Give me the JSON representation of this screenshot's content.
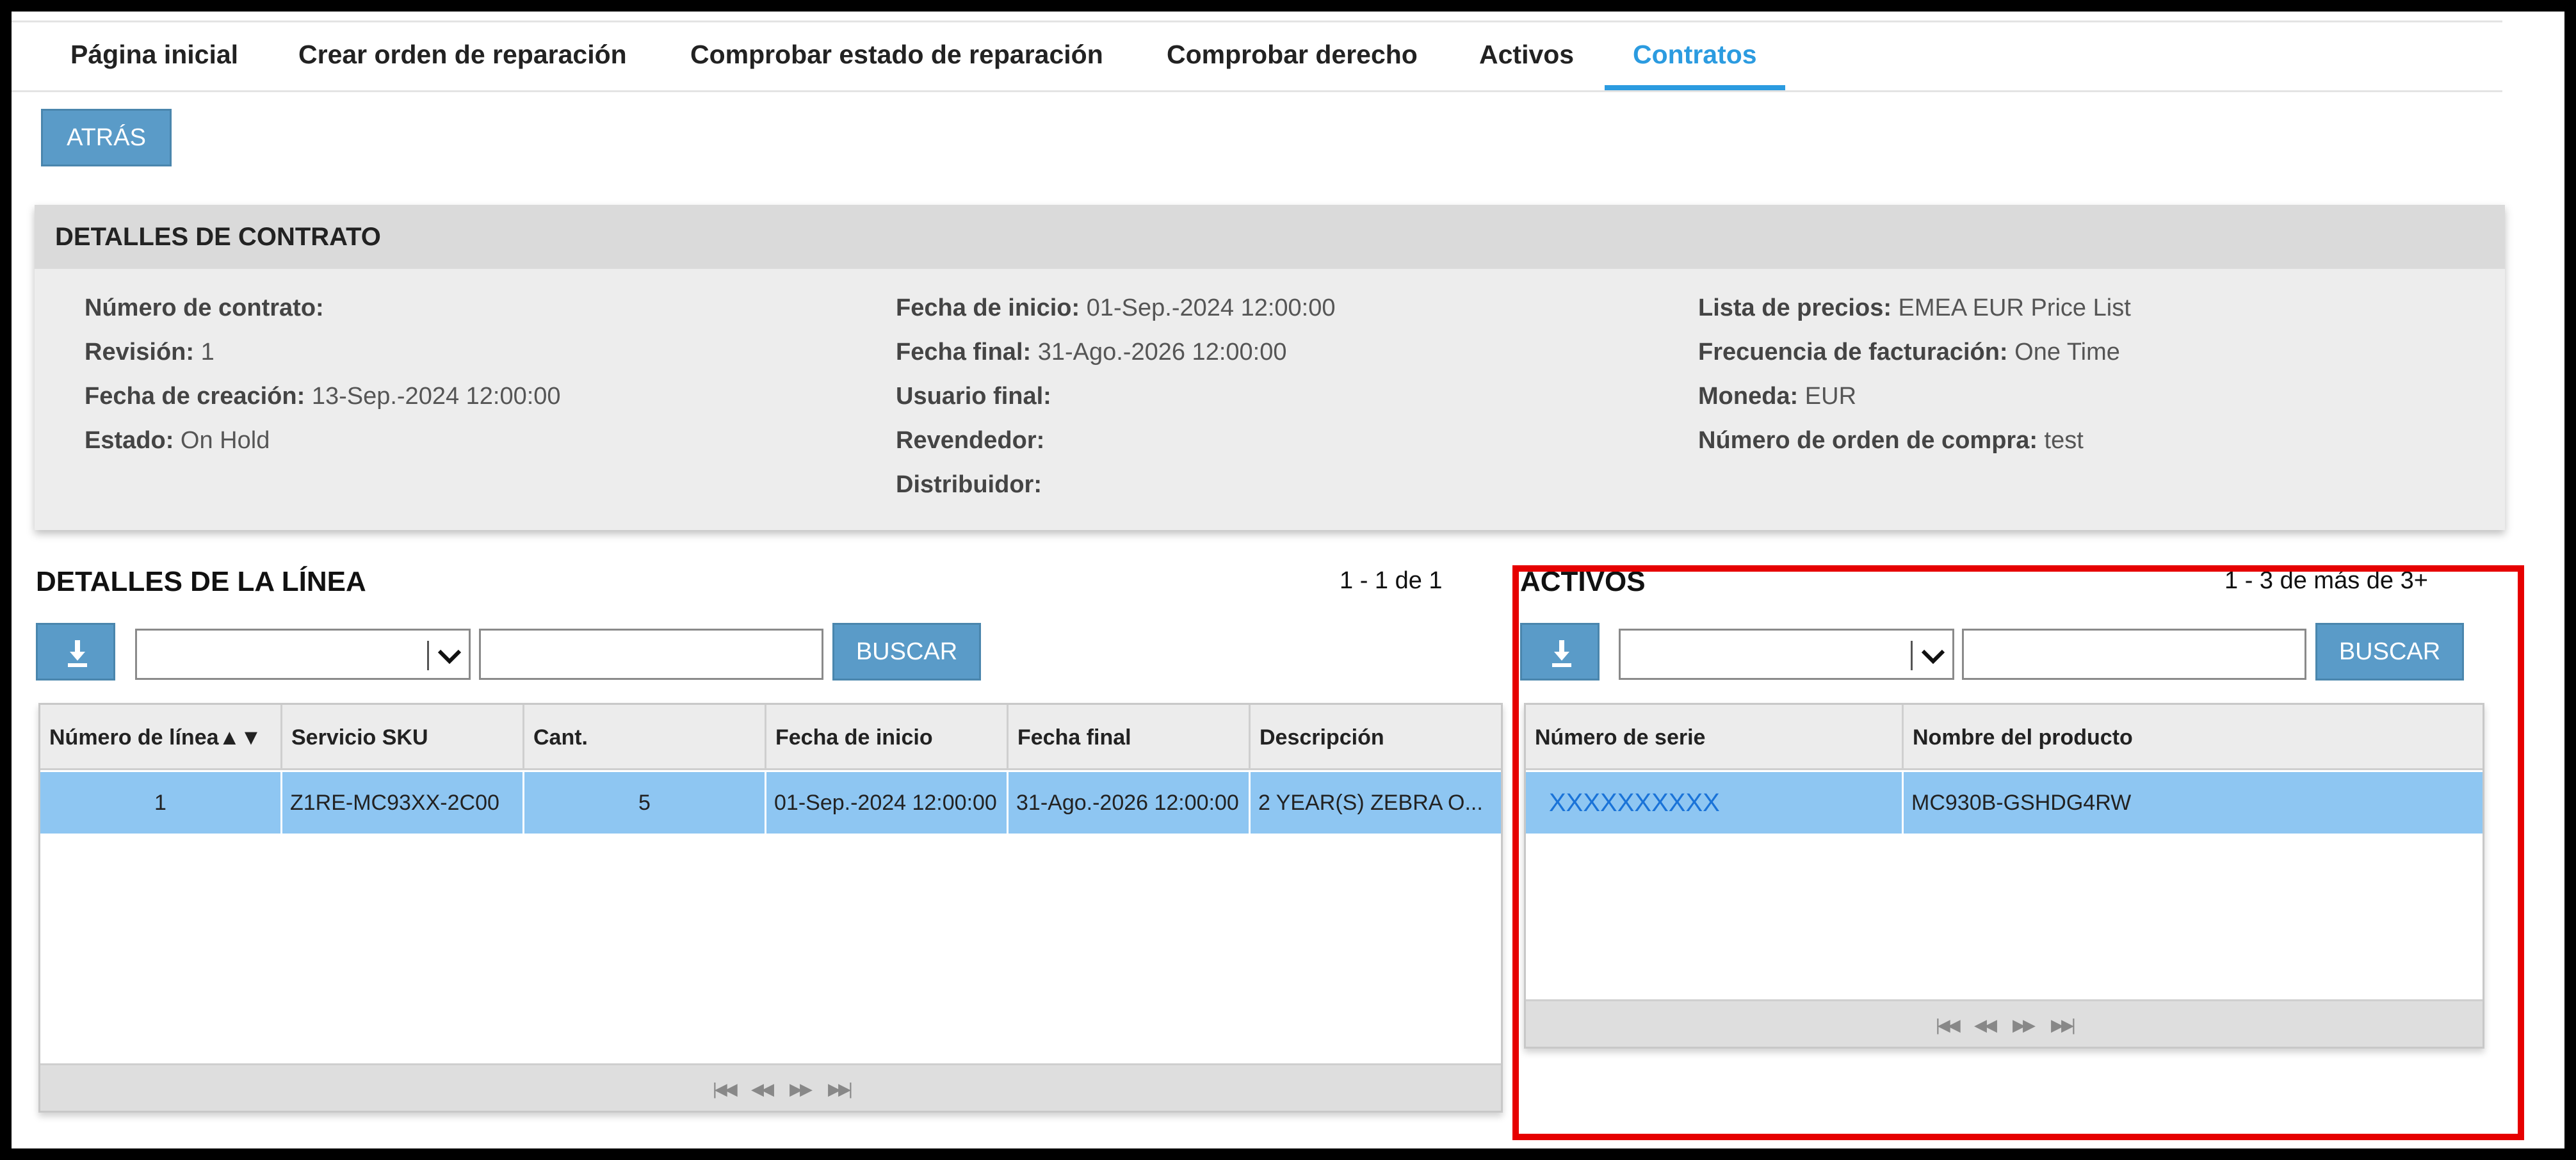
{
  "nav": {
    "tabs": [
      {
        "label": "Página inicial"
      },
      {
        "label": "Crear orden de reparación"
      },
      {
        "label": "Comprobar estado de reparación"
      },
      {
        "label": "Comprobar derecho"
      },
      {
        "label": "Activos"
      },
      {
        "label": "Contratos",
        "active": true
      }
    ]
  },
  "back_button": "ATRÁS",
  "contract": {
    "title": "DETALLES DE CONTRATO",
    "col1": [
      {
        "label": "Número de contrato:",
        "value": ""
      },
      {
        "label": "Revisión:",
        "value": "1"
      },
      {
        "label": "Fecha de creación:",
        "value": "13-Sep.-2024 12:00:00"
      },
      {
        "label": "Estado:",
        "value": "On Hold"
      }
    ],
    "col2": [
      {
        "label": "Fecha de inicio:",
        "value": "01-Sep.-2024 12:00:00"
      },
      {
        "label": "Fecha final:",
        "value": "31-Ago.-2026 12:00:00"
      },
      {
        "label": "Usuario final:",
        "value": ""
      },
      {
        "label": "Revendedor:",
        "value": ""
      },
      {
        "label": "Distribuidor:",
        "value": ""
      }
    ],
    "col3": [
      {
        "label": "Lista de precios:",
        "value": "EMEA EUR Price List"
      },
      {
        "label": "Frecuencia de facturación:",
        "value": "One Time"
      },
      {
        "label": "Moneda:",
        "value": "EUR"
      },
      {
        "label": "Número de orden de compra:",
        "value": "test"
      }
    ]
  },
  "lines": {
    "title": "DETALLES DE LA LÍNEA",
    "count": "1 - 1 de 1",
    "search_button": "BUSCAR",
    "columns": [
      "Número de línea",
      "Servicio SKU",
      "Cant.",
      "Fecha de inicio",
      "Fecha final",
      "Descripción"
    ],
    "sort_indicator": "▲▼",
    "rows": [
      [
        "1",
        "Z1RE-MC93XX-2C00",
        "5",
        "01-Sep.-2024 12:00:00",
        "31-Ago.-2026 12:00:00",
        "2 YEAR(S) ZEBRA O..."
      ]
    ]
  },
  "assets": {
    "title": "ACTIVOS",
    "count": "1 - 3 de más de 3+",
    "search_button": "BUSCAR",
    "columns": [
      "Número de serie",
      "Nombre del producto"
    ],
    "rows": [
      [
        "XXXXXXXXXX",
        "MC930B-GSHDG4RW"
      ]
    ]
  },
  "colors": {
    "accent": "#2b9be0",
    "button": "#5a9bc8",
    "selected_row": "#8ec6f2",
    "highlight": "#e60000"
  },
  "icons": [
    "download-icon",
    "chevron-down-icon",
    "first-page-icon",
    "prev-page-icon",
    "next-page-icon",
    "last-page-icon"
  ]
}
